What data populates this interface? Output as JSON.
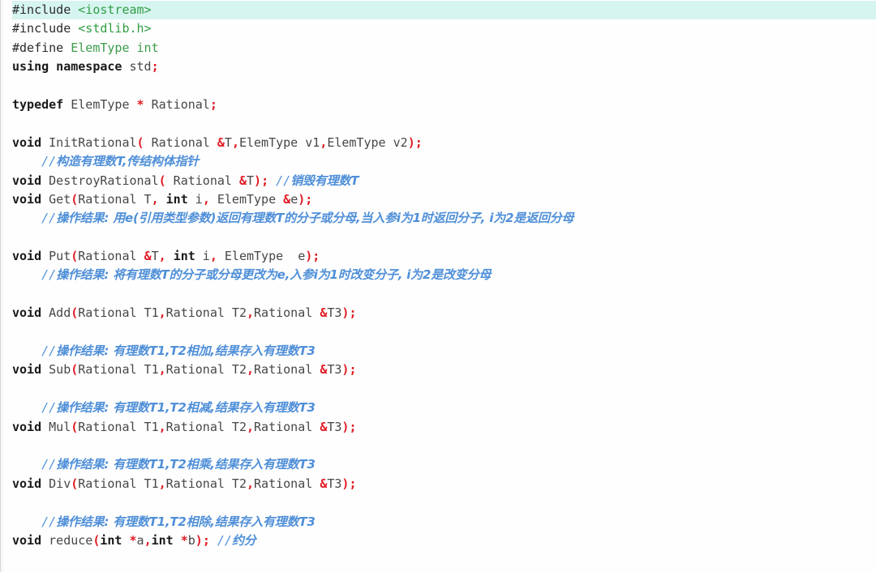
{
  "editor": {
    "name": "code-editor",
    "language": "C++",
    "current_line_index": 0,
    "colors": {
      "background": "#fefefe",
      "current_line_highlight": "#d7f5f0",
      "preprocessor": "#2a2a2a",
      "include_path": "#2f9e44",
      "keyword": "#1a1a1a",
      "type": "#3c9c4a",
      "identifier": "#474747",
      "punctuation": "#e01b24",
      "comment": "#4f8fd8"
    }
  },
  "code": {
    "lines": [
      {
        "highlight": true,
        "tokens": [
          {
            "t": "#include",
            "c": "tok-pre"
          },
          {
            "t": " ",
            "c": "tok-plain"
          },
          {
            "t": "<iostream>",
            "c": "tok-inc"
          }
        ]
      },
      {
        "highlight": false,
        "tokens": [
          {
            "t": "#include",
            "c": "tok-pre"
          },
          {
            "t": " ",
            "c": "tok-plain"
          },
          {
            "t": "<stdlib.h>",
            "c": "tok-inc"
          }
        ]
      },
      {
        "highlight": false,
        "tokens": [
          {
            "t": "#define",
            "c": "tok-pre"
          },
          {
            "t": " ",
            "c": "tok-plain"
          },
          {
            "t": "ElemType",
            "c": "tok-type"
          },
          {
            "t": " ",
            "c": "tok-plain"
          },
          {
            "t": "int",
            "c": "tok-type"
          }
        ]
      },
      {
        "highlight": false,
        "tokens": [
          {
            "t": "using namespace",
            "c": "tok-kw"
          },
          {
            "t": " ",
            "c": "tok-plain"
          },
          {
            "t": "std",
            "c": "tok-plain"
          },
          {
            "t": ";",
            "c": "tok-punc"
          }
        ]
      },
      {
        "highlight": false,
        "tokens": []
      },
      {
        "highlight": false,
        "tokens": [
          {
            "t": "typedef",
            "c": "tok-kw"
          },
          {
            "t": " ElemType ",
            "c": "tok-plain"
          },
          {
            "t": "*",
            "c": "tok-punc"
          },
          {
            "t": " Rational",
            "c": "tok-plain"
          },
          {
            "t": ";",
            "c": "tok-punc"
          }
        ]
      },
      {
        "highlight": false,
        "tokens": []
      },
      {
        "highlight": false,
        "tokens": [
          {
            "t": "void",
            "c": "tok-kw"
          },
          {
            "t": " InitRational",
            "c": "tok-plain"
          },
          {
            "t": "(",
            "c": "tok-punc"
          },
          {
            "t": " Rational ",
            "c": "tok-plain"
          },
          {
            "t": "&",
            "c": "tok-punc"
          },
          {
            "t": "T",
            "c": "tok-plain"
          },
          {
            "t": ",",
            "c": "tok-punc"
          },
          {
            "t": "ElemType v1",
            "c": "tok-plain"
          },
          {
            "t": ",",
            "c": "tok-punc"
          },
          {
            "t": "ElemType v2",
            "c": "tok-plain"
          },
          {
            "t": ")",
            "c": "tok-punc"
          },
          {
            "t": ";",
            "c": "tok-punc"
          }
        ]
      },
      {
        "highlight": false,
        "tokens": [
          {
            "t": "    //",
            "c": "tok-cmt"
          },
          {
            "t": "构造有理数T,传结构体指针",
            "c": "tok-cmt-cn"
          }
        ]
      },
      {
        "highlight": false,
        "tokens": [
          {
            "t": "void",
            "c": "tok-kw"
          },
          {
            "t": " DestroyRational",
            "c": "tok-plain"
          },
          {
            "t": "(",
            "c": "tok-punc"
          },
          {
            "t": " Rational ",
            "c": "tok-plain"
          },
          {
            "t": "&",
            "c": "tok-punc"
          },
          {
            "t": "T",
            "c": "tok-plain"
          },
          {
            "t": ")",
            "c": "tok-punc"
          },
          {
            "t": ";",
            "c": "tok-punc"
          },
          {
            "t": " //",
            "c": "tok-cmt"
          },
          {
            "t": "销毁有理数T",
            "c": "tok-cmt-cn"
          }
        ]
      },
      {
        "highlight": false,
        "tokens": [
          {
            "t": "void",
            "c": "tok-kw"
          },
          {
            "t": " Get",
            "c": "tok-plain"
          },
          {
            "t": "(",
            "c": "tok-punc"
          },
          {
            "t": "Rational T",
            "c": "tok-plain"
          },
          {
            "t": ",",
            "c": "tok-punc"
          },
          {
            "t": " ",
            "c": "tok-plain"
          },
          {
            "t": "int",
            "c": "tok-kw"
          },
          {
            "t": " i",
            "c": "tok-plain"
          },
          {
            "t": ",",
            "c": "tok-punc"
          },
          {
            "t": " ElemType ",
            "c": "tok-plain"
          },
          {
            "t": "&",
            "c": "tok-punc"
          },
          {
            "t": "e",
            "c": "tok-plain"
          },
          {
            "t": ")",
            "c": "tok-punc"
          },
          {
            "t": ";",
            "c": "tok-punc"
          }
        ]
      },
      {
        "highlight": false,
        "tokens": [
          {
            "t": "    //",
            "c": "tok-cmt"
          },
          {
            "t": "操作结果: 用e(引用类型参数)返回有理数T的分子或分母,当入参i为1时返回分子, i为2是返回分母",
            "c": "tok-cmt-cn"
          }
        ]
      },
      {
        "highlight": false,
        "tokens": []
      },
      {
        "highlight": false,
        "tokens": [
          {
            "t": "void",
            "c": "tok-kw"
          },
          {
            "t": " Put",
            "c": "tok-plain"
          },
          {
            "t": "(",
            "c": "tok-punc"
          },
          {
            "t": "Rational ",
            "c": "tok-plain"
          },
          {
            "t": "&",
            "c": "tok-punc"
          },
          {
            "t": "T",
            "c": "tok-plain"
          },
          {
            "t": ",",
            "c": "tok-punc"
          },
          {
            "t": " ",
            "c": "tok-plain"
          },
          {
            "t": "int",
            "c": "tok-kw"
          },
          {
            "t": " i",
            "c": "tok-plain"
          },
          {
            "t": ",",
            "c": "tok-punc"
          },
          {
            "t": " ElemType  e",
            "c": "tok-plain"
          },
          {
            "t": ")",
            "c": "tok-punc"
          },
          {
            "t": ";",
            "c": "tok-punc"
          }
        ]
      },
      {
        "highlight": false,
        "tokens": [
          {
            "t": "    //",
            "c": "tok-cmt"
          },
          {
            "t": "操作结果: 将有理数T的分子或分母更改为e,入参i为1时改变分子, i为2是改变分母",
            "c": "tok-cmt-cn"
          }
        ]
      },
      {
        "highlight": false,
        "tokens": []
      },
      {
        "highlight": false,
        "tokens": [
          {
            "t": "void",
            "c": "tok-kw"
          },
          {
            "t": " Add",
            "c": "tok-plain"
          },
          {
            "t": "(",
            "c": "tok-punc"
          },
          {
            "t": "Rational T1",
            "c": "tok-plain"
          },
          {
            "t": ",",
            "c": "tok-punc"
          },
          {
            "t": "Rational T2",
            "c": "tok-plain"
          },
          {
            "t": ",",
            "c": "tok-punc"
          },
          {
            "t": "Rational ",
            "c": "tok-plain"
          },
          {
            "t": "&",
            "c": "tok-punc"
          },
          {
            "t": "T3",
            "c": "tok-plain"
          },
          {
            "t": ")",
            "c": "tok-punc"
          },
          {
            "t": ";",
            "c": "tok-punc"
          }
        ]
      },
      {
        "highlight": false,
        "tokens": []
      },
      {
        "highlight": false,
        "tokens": [
          {
            "t": "    //",
            "c": "tok-cmt"
          },
          {
            "t": "操作结果: 有理数T1,T2相加,结果存入有理数T3",
            "c": "tok-cmt-cn"
          }
        ]
      },
      {
        "highlight": false,
        "tokens": [
          {
            "t": "void",
            "c": "tok-kw"
          },
          {
            "t": " Sub",
            "c": "tok-plain"
          },
          {
            "t": "(",
            "c": "tok-punc"
          },
          {
            "t": "Rational T1",
            "c": "tok-plain"
          },
          {
            "t": ",",
            "c": "tok-punc"
          },
          {
            "t": "Rational T2",
            "c": "tok-plain"
          },
          {
            "t": ",",
            "c": "tok-punc"
          },
          {
            "t": "Rational ",
            "c": "tok-plain"
          },
          {
            "t": "&",
            "c": "tok-punc"
          },
          {
            "t": "T3",
            "c": "tok-plain"
          },
          {
            "t": ")",
            "c": "tok-punc"
          },
          {
            "t": ";",
            "c": "tok-punc"
          }
        ]
      },
      {
        "highlight": false,
        "tokens": []
      },
      {
        "highlight": false,
        "tokens": [
          {
            "t": "    //",
            "c": "tok-cmt"
          },
          {
            "t": "操作结果: 有理数T1,T2相减,结果存入有理数T3",
            "c": "tok-cmt-cn"
          }
        ]
      },
      {
        "highlight": false,
        "tokens": [
          {
            "t": "void",
            "c": "tok-kw"
          },
          {
            "t": " Mul",
            "c": "tok-plain"
          },
          {
            "t": "(",
            "c": "tok-punc"
          },
          {
            "t": "Rational T1",
            "c": "tok-plain"
          },
          {
            "t": ",",
            "c": "tok-punc"
          },
          {
            "t": "Rational T2",
            "c": "tok-plain"
          },
          {
            "t": ",",
            "c": "tok-punc"
          },
          {
            "t": "Rational ",
            "c": "tok-plain"
          },
          {
            "t": "&",
            "c": "tok-punc"
          },
          {
            "t": "T3",
            "c": "tok-plain"
          },
          {
            "t": ")",
            "c": "tok-punc"
          },
          {
            "t": ";",
            "c": "tok-punc"
          }
        ]
      },
      {
        "highlight": false,
        "tokens": []
      },
      {
        "highlight": false,
        "tokens": [
          {
            "t": "    //",
            "c": "tok-cmt"
          },
          {
            "t": "操作结果: 有理数T1,T2相乘,结果存入有理数T3",
            "c": "tok-cmt-cn"
          }
        ]
      },
      {
        "highlight": false,
        "tokens": [
          {
            "t": "void",
            "c": "tok-kw"
          },
          {
            "t": " Div",
            "c": "tok-plain"
          },
          {
            "t": "(",
            "c": "tok-punc"
          },
          {
            "t": "Rational T1",
            "c": "tok-plain"
          },
          {
            "t": ",",
            "c": "tok-punc"
          },
          {
            "t": "Rational T2",
            "c": "tok-plain"
          },
          {
            "t": ",",
            "c": "tok-punc"
          },
          {
            "t": "Rational ",
            "c": "tok-plain"
          },
          {
            "t": "&",
            "c": "tok-punc"
          },
          {
            "t": "T3",
            "c": "tok-plain"
          },
          {
            "t": ")",
            "c": "tok-punc"
          },
          {
            "t": ";",
            "c": "tok-punc"
          }
        ]
      },
      {
        "highlight": false,
        "tokens": []
      },
      {
        "highlight": false,
        "tokens": [
          {
            "t": "    //",
            "c": "tok-cmt"
          },
          {
            "t": "操作结果: 有理数T1,T2相除,结果存入有理数T3",
            "c": "tok-cmt-cn"
          }
        ]
      },
      {
        "highlight": false,
        "tokens": [
          {
            "t": "void",
            "c": "tok-kw"
          },
          {
            "t": " reduce",
            "c": "tok-plain"
          },
          {
            "t": "(",
            "c": "tok-punc"
          },
          {
            "t": "int",
            "c": "tok-kw"
          },
          {
            "t": " ",
            "c": "tok-plain"
          },
          {
            "t": "*",
            "c": "tok-punc"
          },
          {
            "t": "a",
            "c": "tok-plain"
          },
          {
            "t": ",",
            "c": "tok-punc"
          },
          {
            "t": "int",
            "c": "tok-kw"
          },
          {
            "t": " ",
            "c": "tok-plain"
          },
          {
            "t": "*",
            "c": "tok-punc"
          },
          {
            "t": "b",
            "c": "tok-plain"
          },
          {
            "t": ")",
            "c": "tok-punc"
          },
          {
            "t": ";",
            "c": "tok-punc"
          },
          {
            "t": " //",
            "c": "tok-cmt"
          },
          {
            "t": "约分",
            "c": "tok-cmt-cn"
          }
        ]
      }
    ]
  }
}
